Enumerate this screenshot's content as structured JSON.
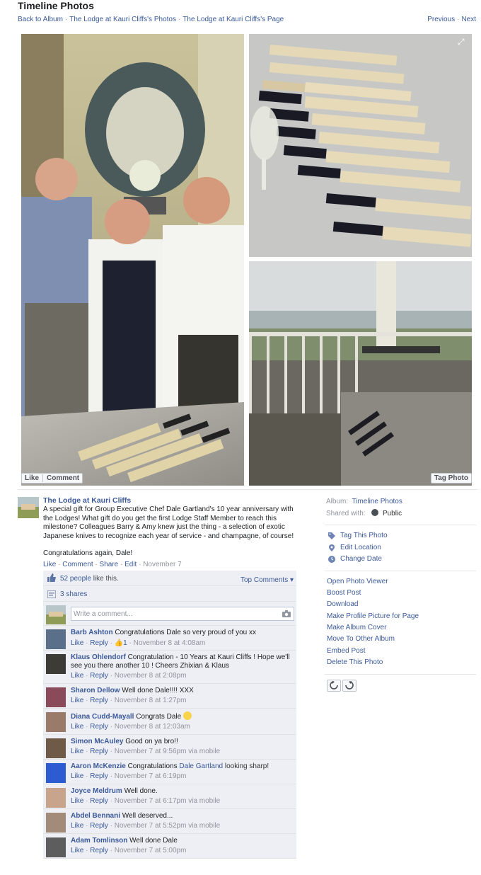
{
  "header": {
    "title": "Timeline Photos",
    "breadcrumbs": [
      "Back to Album",
      "The Lodge at Kauri Cliffs's Photos",
      "The Lodge at Kauri Cliffs's Page"
    ],
    "separator": "·",
    "previous": "Previous",
    "next": "Next"
  },
  "photo": {
    "like_label": "Like",
    "comment_label": "Comment",
    "tag_label": "Tag Photo"
  },
  "post": {
    "author": "The Lodge at Kauri Cliffs",
    "text": "A special gift for Group Executive Chef Dale Gartland's 10 year anniversary with the Lodges! What gift do you get the first Lodge Staff Member to reach this milestone? Colleagues Barry & Amy knew just the thing - a selection of exotic Japanese knives to recognize each year of service - and champagne, of course!",
    "congrats": "Congratulations again, Dale!",
    "actions": [
      "Like",
      "Comment",
      "Share",
      "Edit"
    ],
    "date": "November 7"
  },
  "ufi": {
    "likes_link": "52 people",
    "likes_suffix": " like this.",
    "top_comments": "Top Comments ▾",
    "shares": "3 shares",
    "write_placeholder": "Write a comment..."
  },
  "comments": [
    {
      "name": "Barb Ashton",
      "text": "Congratulations Dale so very proud of you xx",
      "like": "Like",
      "reply": "Reply",
      "likes": "1",
      "time": "November 8 at 4:08am",
      "via": ""
    },
    {
      "name": "Klaus Ohlendorf",
      "text": "Congratulation - 10 Years at Kauri Cliffs ! Hope we'll see you there another 10 ! Cheers Zhixian & Klaus",
      "like": "Like",
      "reply": "Reply",
      "likes": "",
      "time": "November 8 at 2:08pm",
      "via": ""
    },
    {
      "name": "Sharon Dellow",
      "text": "Well done Dale!!!! XXX",
      "like": "Like",
      "reply": "Reply",
      "likes": "",
      "time": "November 8 at 1:27pm",
      "via": ""
    },
    {
      "name": "Diana Cudd-Mayall",
      "text": "Congrats Dale",
      "like": "Like",
      "reply": "Reply",
      "likes": "",
      "time": "November 8 at 12:03am",
      "via": ""
    },
    {
      "name": "Simon McAuley",
      "text": "Good on ya bro!!",
      "like": "Like",
      "reply": "Reply",
      "likes": "",
      "time": "November 7 at 9:56pm",
      "via": "via mobile"
    },
    {
      "name": "Aaron McKenzie",
      "text": "Congratulations",
      "mention": "Dale Gartland",
      "text_after": " looking sharp!",
      "like": "Like",
      "reply": "Reply",
      "likes": "",
      "time": "November 7 at 6:19pm",
      "via": ""
    },
    {
      "name": "Joyce Meldrum",
      "text": "Well done.",
      "like": "Like",
      "reply": "Reply",
      "likes": "",
      "time": "November 7 at 6:17pm",
      "via": "via mobile"
    },
    {
      "name": "Abdel Bennani",
      "text": "Well deserved...",
      "like": "Like",
      "reply": "Reply",
      "likes": "",
      "time": "November 7 at 5:52pm",
      "via": "via mobile"
    },
    {
      "name": "Adam Tomlinson",
      "text": "Well done Dale",
      "like": "Like",
      "reply": "Reply",
      "likes": "",
      "time": "November 7 at 5:00pm",
      "via": ""
    }
  ],
  "sidebar": {
    "album_label": "Album:",
    "album_value": "Timeline Photos",
    "shared_label": "Shared with:",
    "shared_value": "Public",
    "actions": [
      "Tag This Photo",
      "Edit Location",
      "Change Date"
    ],
    "options": [
      "Open Photo Viewer",
      "Boost Post",
      "Download",
      "Make Profile Picture for Page",
      "Make Album Cover",
      "Move To Other Album",
      "Embed Post",
      "Delete This Photo"
    ]
  },
  "colors": {
    "link": "#3b5998",
    "ufi_bg": "#edeff4",
    "meta_grey": "#90949c"
  }
}
